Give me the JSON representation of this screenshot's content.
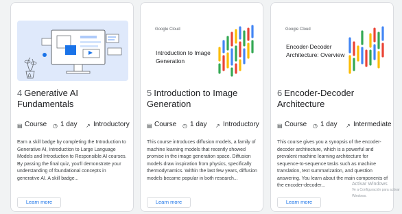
{
  "cards": [
    {
      "number": "4",
      "title": "Generative AI Fundamentals",
      "type": "Course",
      "duration": "1 day",
      "level": "Introductory",
      "description": "Earn a skill badge by completing the Introduction to Generative AI, Introduction to Large Language Models and Introduction to Responsible AI courses. By passing the final quiz, you'll demonstrate your understanding of foundational concepts in generative AI. A skill badge...",
      "button": "Learn more"
    },
    {
      "number": "5",
      "title": "Introduction to Image Generation",
      "type": "Course",
      "duration": "1 day",
      "level": "Introductory",
      "thumb_logo": "Google Cloud",
      "thumb_title": "Introduction to Image Generation",
      "description": "This course introduces diffusion models, a family of machine learning models that recently showed promise in the image generation space. Diffusion models draw inspiration from physics, specifically thermodynamics. Within the last few years, diffusion models became popular in both research...",
      "button": "Learn more"
    },
    {
      "number": "6",
      "title": "Encoder-Decoder Architecture",
      "type": "Course",
      "duration": "1 day",
      "level": "Intermediate",
      "thumb_logo": "Google Cloud",
      "thumb_title": "Encoder-Decoder Architecture: Overview",
      "description": "This course gives you a synopsis of the encoder-decoder architecture, which is a powerful and prevalent machine learning architecture for sequence-to-sequence tasks such as machine translation, text summarization, and question answering. You learn about the main components of the encoder-decoder...",
      "button": "Learn more"
    }
  ],
  "watermark": {
    "line1": "Activar Windows",
    "line2": "Ve a Configuración para activar Windows."
  },
  "icons": {
    "type": "book-icon",
    "duration": "calendar-icon",
    "level": "trend-icon"
  }
}
